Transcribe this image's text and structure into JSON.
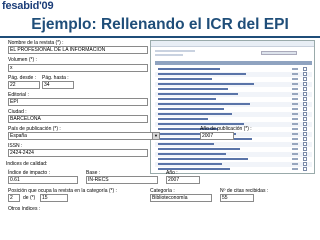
{
  "header": {
    "logo": "fesabid'09",
    "title": "Ejemplo: Rellenando el ICR del EPI"
  },
  "form": {
    "nombre_label": "Nombre de la revista (*) :",
    "nombre_value": "EL PROFESIONAL DE LA INFORMACION",
    "volumen_label": "Volumen (*) :",
    "volumen_value": "x",
    "pag_desde_label": "Pág. desde :",
    "pag_desde_value": "22",
    "pag_hasta_label": "Pág. hasta :",
    "pag_hasta_value": "34",
    "editorial_label": "Editorial :",
    "editorial_value": "EPI",
    "ciudad_label": "Ciudad :",
    "ciudad_value": "BARCELONA",
    "pais_label": "País de publicación (*) :",
    "pais_value": "España",
    "anio_pub_label": "Año de publicación (*) :",
    "anio_pub_value": "2007",
    "issn_label": "ISSN :",
    "issn_value": "2424-2424"
  },
  "indices": {
    "section_label": "Indices de calidad:",
    "impacto_label": "Índice de impacto :",
    "impacto_value": "0.61",
    "base_label": "Base :",
    "base_value": "IN-RECS",
    "anio_label": "Año :",
    "anio_value": "2007",
    "posicion_label": "Posición que ocupa la revista en la categoría (*) :",
    "posicion_value": "2",
    "de_label": "de (*)",
    "de_value": "15",
    "categoria_label": "Categoría :",
    "categoria_value": "Biblioteconomía",
    "citas_label": "Nº de citas recibidas :",
    "citas_value": "55",
    "otros_label": "Otros índices :"
  },
  "colors": {
    "title": "#1f4e79",
    "logo": "#1d3f7a"
  }
}
